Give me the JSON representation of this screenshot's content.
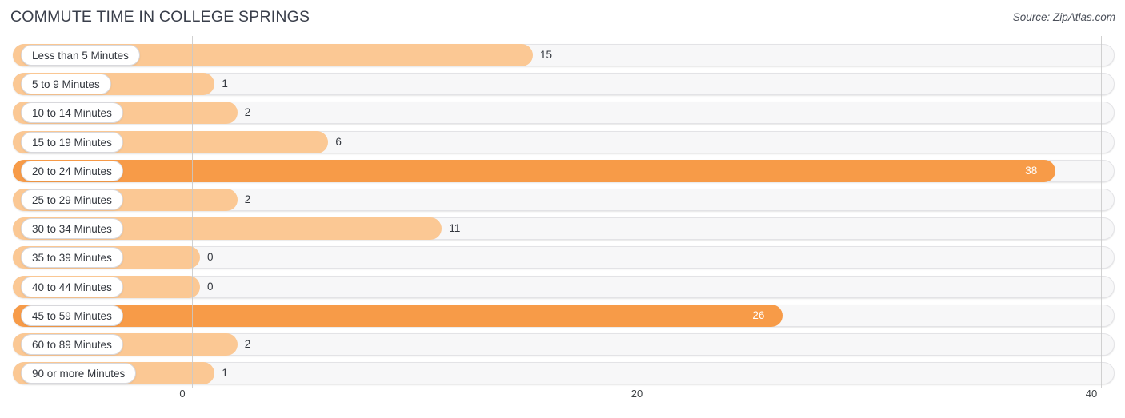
{
  "header": {
    "title": "COMMUTE TIME IN COLLEGE SPRINGS",
    "source": "Source: ZipAtlas.com"
  },
  "colors": {
    "bar_light": "#fbc894",
    "bar_dark": "#f79b48",
    "track": "#f7f7f8",
    "track_border": "#e3e3e6",
    "gridline": "#c9c9c9",
    "text": "#32363d",
    "title": "#3a3f4b"
  },
  "chart_data": {
    "type": "bar",
    "orientation": "horizontal",
    "title": "COMMUTE TIME IN COLLEGE SPRINGS",
    "subtitle": "",
    "xlabel": "",
    "ylabel": "",
    "xlim": [
      0,
      40
    ],
    "xticks": [
      0,
      20,
      40
    ],
    "xtick_labels": [
      "0",
      "20",
      "40"
    ],
    "grid": true,
    "legend": null,
    "annotations": [
      "Source: ZipAtlas.com"
    ],
    "categories": [
      "Less than 5 Minutes",
      "5 to 9 Minutes",
      "10 to 14 Minutes",
      "15 to 19 Minutes",
      "20 to 24 Minutes",
      "25 to 29 Minutes",
      "30 to 34 Minutes",
      "35 to 39 Minutes",
      "40 to 44 Minutes",
      "45 to 59 Minutes",
      "60 to 89 Minutes",
      "90 or more Minutes"
    ],
    "values": [
      15,
      1,
      2,
      6,
      38,
      2,
      11,
      0,
      0,
      26,
      2,
      1
    ],
    "value_labels": [
      "15",
      "1",
      "2",
      "6",
      "38",
      "2",
      "11",
      "0",
      "0",
      "26",
      "2",
      "1"
    ]
  },
  "rows": [
    {
      "label": "Less than 5 Minutes",
      "value": 15,
      "value_label": "15",
      "shade": "light",
      "label_inside": false
    },
    {
      "label": "5 to 9 Minutes",
      "value": 1,
      "value_label": "1",
      "shade": "light",
      "label_inside": false
    },
    {
      "label": "10 to 14 Minutes",
      "value": 2,
      "value_label": "2",
      "shade": "light",
      "label_inside": false
    },
    {
      "label": "15 to 19 Minutes",
      "value": 6,
      "value_label": "6",
      "shade": "light",
      "label_inside": false
    },
    {
      "label": "20 to 24 Minutes",
      "value": 38,
      "value_label": "38",
      "shade": "dark",
      "label_inside": true
    },
    {
      "label": "25 to 29 Minutes",
      "value": 2,
      "value_label": "2",
      "shade": "light",
      "label_inside": false
    },
    {
      "label": "30 to 34 Minutes",
      "value": 11,
      "value_label": "11",
      "shade": "light",
      "label_inside": false
    },
    {
      "label": "35 to 39 Minutes",
      "value": 0,
      "value_label": "0",
      "shade": "light",
      "label_inside": false
    },
    {
      "label": "40 to 44 Minutes",
      "value": 0,
      "value_label": "0",
      "shade": "light",
      "label_inside": false
    },
    {
      "label": "45 to 59 Minutes",
      "value": 26,
      "value_label": "26",
      "shade": "dark",
      "label_inside": true
    },
    {
      "label": "60 to 89 Minutes",
      "value": 2,
      "value_label": "2",
      "shade": "light",
      "label_inside": false
    },
    {
      "label": "90 or more Minutes",
      "value": 1,
      "value_label": "1",
      "shade": "light",
      "label_inside": false
    }
  ],
  "axis": {
    "ticks": [
      {
        "label": "0",
        "value": 0
      },
      {
        "label": "20",
        "value": 20
      },
      {
        "label": "40",
        "value": 40
      }
    ]
  }
}
